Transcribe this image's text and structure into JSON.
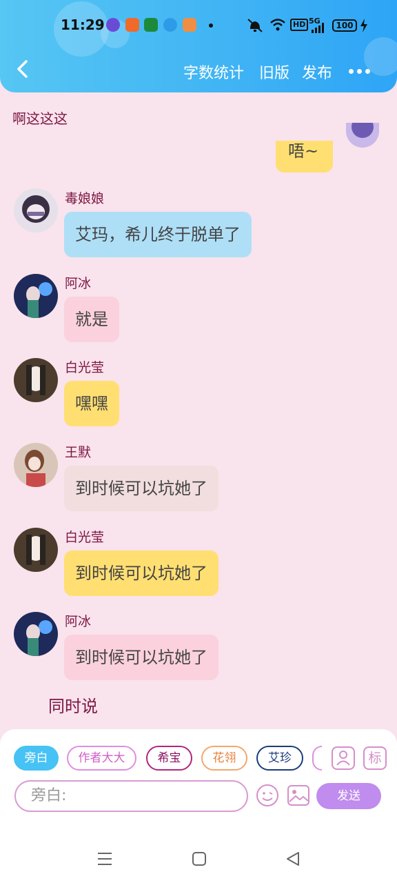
{
  "status_bar": {
    "time": "11:29",
    "network": "5G",
    "hd": "HD",
    "battery": "100"
  },
  "header": {
    "actions": [
      "字数统计",
      "旧版",
      "发布"
    ]
  },
  "chat": {
    "title": "啊这这这",
    "partial_bubble": "唔~",
    "messages": [
      {
        "name": "毒娘娘",
        "text": "艾玛，希儿终于脱单了",
        "bubble_color": "#aedff6"
      },
      {
        "name": "阿冰",
        "text": "就是",
        "bubble_color": "#fbd1dd"
      },
      {
        "name": "白光莹",
        "text": "嘿嘿",
        "bubble_color": "#ffdf72"
      },
      {
        "name": "王默",
        "text": "到时候可以坑她了",
        "bubble_color": "#f2dede"
      },
      {
        "name": "白光莹",
        "text": "到时候可以坑她了",
        "bubble_color": "#ffdf72"
      },
      {
        "name": "阿冰",
        "text": "到时候可以坑她了",
        "bubble_color": "#fbd1dd"
      }
    ],
    "narration": "同时说"
  },
  "composer": {
    "roles": [
      {
        "label": "旁白",
        "color": "#47c2f4"
      },
      {
        "label": "作者大大",
        "color": "#e08de0"
      },
      {
        "label": "希宝",
        "color": "#b0267a"
      },
      {
        "label": "花翎",
        "color": "#f3a76b"
      },
      {
        "label": "艾珍",
        "color": "#1a3c7a"
      }
    ],
    "tool_label": "标",
    "input_placeholder": "旁白:",
    "send_label": "发送"
  }
}
